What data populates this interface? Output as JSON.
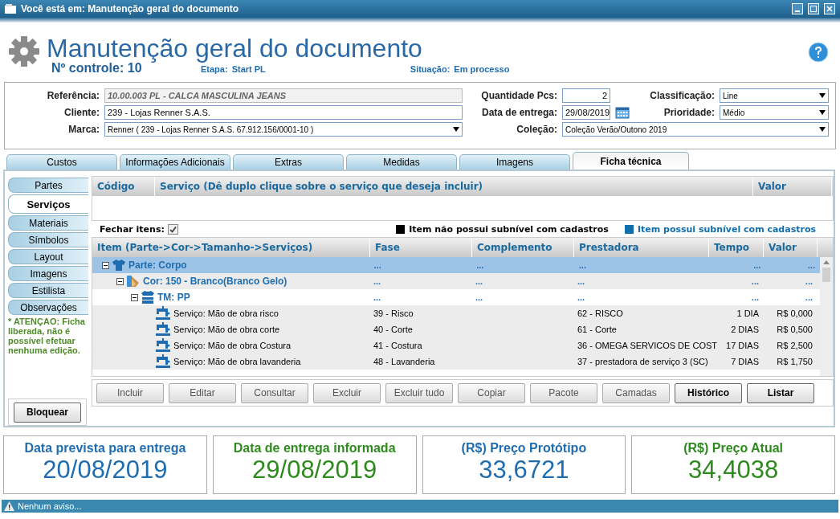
{
  "window": {
    "title": "Você está em: Manutenção geral do documento"
  },
  "header": {
    "title": "Manutenção geral do documento",
    "control": "Nº controle: 10",
    "stage_label": "Etapa:",
    "stage": "Start PL",
    "status_label": "Situação:",
    "status": "Em processo"
  },
  "form": {
    "reference": {
      "label": "Referência:",
      "value": "10.00.003 PL - CALCA MASCULINA JEANS"
    },
    "client": {
      "label": "Cliente:",
      "value": "239 - Lojas Renner S.A.S."
    },
    "brand": {
      "label": "Marca:",
      "value": "Renner ( 239 - Lojas Renner S.A.S. 67.912.156/0001-10 )"
    },
    "quantity": {
      "label": "Quantidade Pcs:",
      "value": "2"
    },
    "delivery": {
      "label": "Data de entrega:",
      "value": "29/08/2019"
    },
    "classification": {
      "label": "Classificação:",
      "value": "Line"
    },
    "priority": {
      "label": "Prioridade:",
      "value": "Médio"
    },
    "collection": {
      "label": "Coleção:",
      "value": "Coleção Verão/Outono 2019"
    }
  },
  "tabs": [
    {
      "label": "Custos",
      "selected": false
    },
    {
      "label": "Informações Adicionais",
      "selected": false
    },
    {
      "label": "Extras",
      "selected": false
    },
    {
      "label": "Medidas",
      "selected": false
    },
    {
      "label": "Imagens",
      "selected": false
    },
    {
      "label": "Ficha técnica",
      "selected": true
    }
  ],
  "sidebar": {
    "items": [
      {
        "label": "Partes",
        "selected": false
      },
      {
        "label": "Serviços",
        "selected": true
      },
      {
        "label": "Materiais",
        "selected": false
      },
      {
        "label": "Símbolos",
        "selected": false
      },
      {
        "label": "Layout",
        "selected": false
      },
      {
        "label": "Imagens",
        "selected": false
      },
      {
        "label": "Estilista",
        "selected": false
      },
      {
        "label": "Observações",
        "selected": false
      }
    ],
    "warning": "* ATENÇAO: Ficha liberada, não é possível efetuar nenhuma edição.",
    "lock_button": "Bloquear"
  },
  "services_table": {
    "columns": [
      "Código",
      "Serviço (Dê duplo clique sobre o serviço que deseja incluir)",
      "Valor"
    ]
  },
  "close_items": {
    "label": "Fechar itens:",
    "checked": true
  },
  "legend": [
    {
      "label": "Item não possui subnível com cadastros",
      "color": "#000000"
    },
    {
      "label": "Item possui subnível com cadastros",
      "color": "#0f6fae"
    }
  ],
  "tree": {
    "columns": [
      "Item (Parte->Cor->Tamanho->Serviços)",
      "Fase",
      "Complemento",
      "Prestadora",
      "Tempo",
      "Valor"
    ],
    "rows": [
      {
        "kind": "part",
        "selected": true,
        "expanded": true,
        "cells": [
          "Parte: Corpo",
          "...",
          "...",
          "...",
          "...",
          "..."
        ],
        "children": [
          {
            "kind": "color",
            "selected": false,
            "expanded": true,
            "cells": [
              "Cor: 150 - Branco(Branco Gelo)",
              "...",
              "...",
              "...",
              "...",
              "..."
            ],
            "children": [
              {
                "kind": "size",
                "selected": false,
                "expanded": true,
                "cells": [
                  "TM: PP",
                  "...",
                  "...",
                  "...",
                  "...",
                  "..."
                ],
                "children": [
                  {
                    "kind": "service",
                    "selected": false,
                    "cells": [
                      "Serviço: Mão de obra risco",
                      "39 - Risco",
                      "",
                      "62 - RISCO",
                      "1 DIA",
                      "R$ 0,000"
                    ]
                  },
                  {
                    "kind": "service",
                    "selected": false,
                    "cells": [
                      "Serviço: Mão de obra corte",
                      "40 - Corte",
                      "",
                      "61 - Corte",
                      "2 DIAS",
                      "R$ 0,500"
                    ]
                  },
                  {
                    "kind": "service",
                    "selected": false,
                    "cells": [
                      "Serviço: Mão de obra Costura",
                      "41 - Costura",
                      "",
                      "36 - OMEGA SERVICOS DE COST",
                      "17 DIAS",
                      "R$ 2,500"
                    ]
                  },
                  {
                    "kind": "service",
                    "selected": false,
                    "cells": [
                      "Serviço: Mão de obra lavanderia",
                      "48 - Lavanderia",
                      "",
                      "37 - prestadora de serviço 3 (SC)",
                      "7 DIAS",
                      "R$ 1,750"
                    ]
                  }
                ]
              }
            ]
          }
        ]
      }
    ]
  },
  "actions": [
    {
      "label": "Incluir",
      "disabled": true
    },
    {
      "label": "Editar",
      "disabled": true
    },
    {
      "label": "Consultar",
      "disabled": true
    },
    {
      "label": "Excluir",
      "disabled": true
    },
    {
      "label": "Excluir tudo",
      "disabled": true
    },
    {
      "label": "Copiar",
      "disabled": true
    },
    {
      "label": "Pacote",
      "disabled": true
    },
    {
      "label": "Camadas",
      "disabled": true
    },
    {
      "label": "Histórico",
      "disabled": false
    },
    {
      "label": "Listar",
      "disabled": false
    }
  ],
  "summary": [
    {
      "title": "Data prevista para entrega",
      "value": "20/08/2019",
      "color": "#1f6db0"
    },
    {
      "title": "Data de entrega informada",
      "value": "29/08/2019",
      "color": "#2e8a1e"
    },
    {
      "title": "(R$) Preço Protótipo",
      "value": "33,6721",
      "color": "#1f6db0"
    },
    {
      "title": "(R$) Preço Atual",
      "value": "34,4038",
      "color": "#2e8a1e"
    }
  ],
  "status_bar": "Nenhum aviso..."
}
